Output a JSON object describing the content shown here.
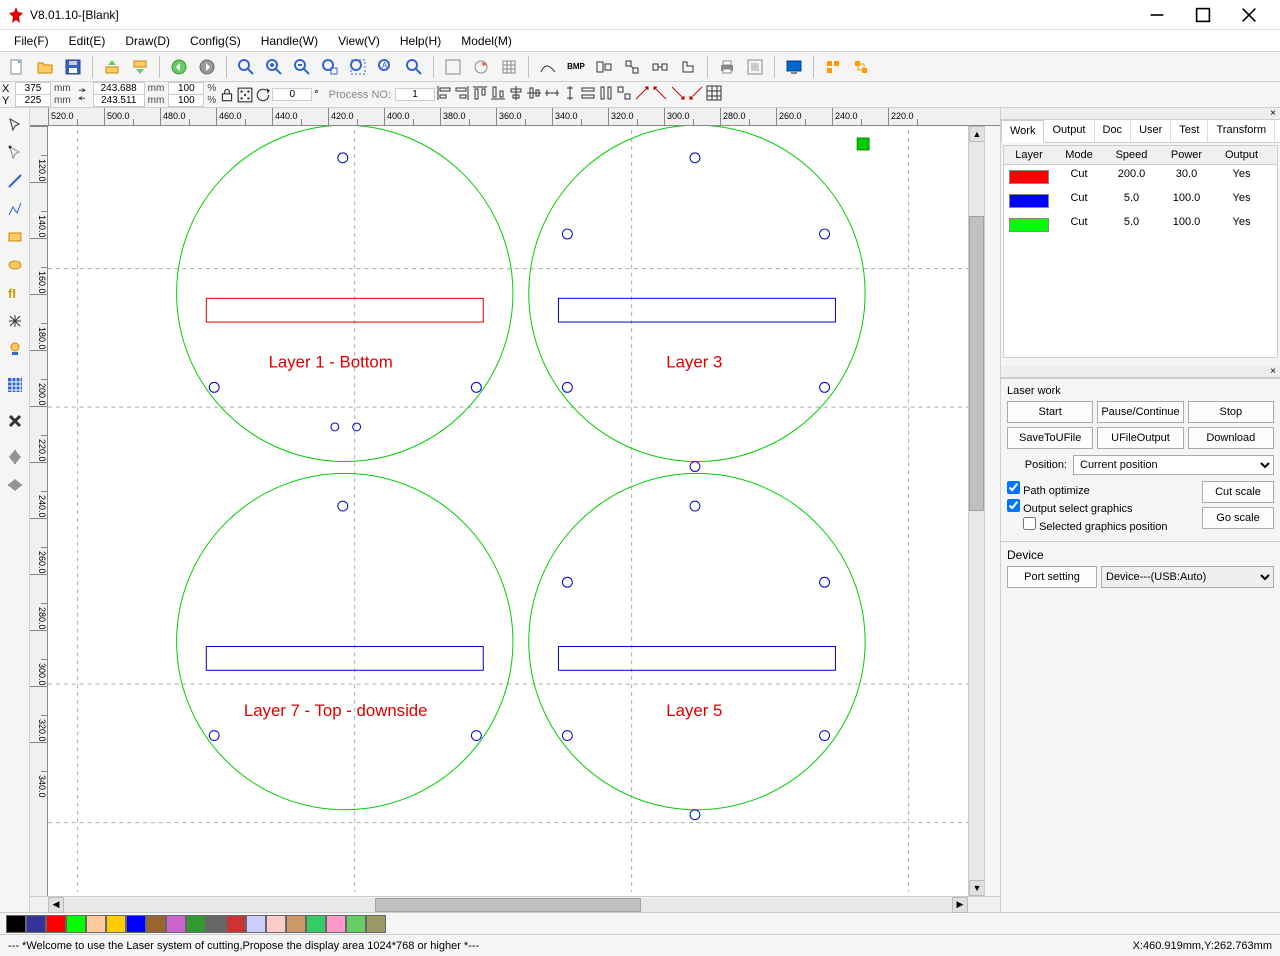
{
  "window": {
    "title": "V8.01.10-[Blank]"
  },
  "menu": {
    "file": "File(F)",
    "edit": "Edit(E)",
    "draw": "Draw(D)",
    "config": "Config(S)",
    "handle": "Handle(W)",
    "view": "View(V)",
    "help": "Help(H)",
    "model": "Model(M)"
  },
  "coords": {
    "x_label": "X",
    "x_val": "375",
    "x_unit": "mm",
    "y_label": "Y",
    "y_val": "225",
    "y_unit": "mm",
    "w_val": "243.688",
    "w_unit": "mm",
    "h_val": "243.511",
    "h_unit": "mm",
    "sx_val": "100",
    "sx_unit": "%",
    "sy_val": "100",
    "sy_unit": "%",
    "rot_val": "0",
    "process_label": "Process NO:",
    "process_val": "1"
  },
  "ruler_h": [
    "520.0",
    "500.0",
    "480.0",
    "460.0",
    "440.0",
    "420.0",
    "400.0",
    "380.0",
    "360.0",
    "340.0",
    "320.0",
    "300.0",
    "280.0",
    "260.0",
    "240.0",
    "220.0"
  ],
  "ruler_v": [
    "120.0",
    "140.0",
    "160.0",
    "180.0",
    "200.0",
    "220.0",
    "240.0",
    "260.0",
    "280.0",
    "300.0",
    "320.0",
    "340.0"
  ],
  "canvas": {
    "labels": {
      "l1": "Layer 1 - Bottom",
      "l3": "Layer 3",
      "l7": "Layer 7 - Top - downside",
      "l5": "Layer 5"
    }
  },
  "rp": {
    "tabs": {
      "work": "Work",
      "output": "Output",
      "doc": "Doc",
      "user": "User",
      "test": "Test",
      "transform": "Transform"
    },
    "layer_hdr": {
      "layer": "Layer",
      "mode": "Mode",
      "speed": "Speed",
      "power": "Power",
      "output": "Output"
    },
    "layers": [
      {
        "color": "#ff0000",
        "mode": "Cut",
        "speed": "200.0",
        "power": "30.0",
        "output": "Yes"
      },
      {
        "color": "#0000ff",
        "mode": "Cut",
        "speed": "5.0",
        "power": "100.0",
        "output": "Yes"
      },
      {
        "color": "#00ff00",
        "mode": "Cut",
        "speed": "5.0",
        "power": "100.0",
        "output": "Yes"
      }
    ],
    "laser_work_title": "Laser work",
    "btns": {
      "start": "Start",
      "pause": "Pause/Continue",
      "stop": "Stop",
      "saveu": "SaveToUFile",
      "ufile": "UFileOutput",
      "download": "Download"
    },
    "position_label": "Position:",
    "position_value": "Current position",
    "chk_path": "Path optimize",
    "chk_outsel": "Output select graphics",
    "chk_selpos": "Selected graphics position",
    "cut_scale": "Cut scale",
    "go_scale": "Go scale",
    "device_title": "Device",
    "port_setting": "Port setting",
    "device_value": "Device---(USB:Auto)"
  },
  "palette": [
    "#000000",
    "#333399",
    "#ff0000",
    "#00ff00",
    "#ffcc99",
    "#ffcc00",
    "#0000ff",
    "#996633",
    "#cc66cc",
    "#339933",
    "#666666",
    "#cc3333",
    "#ccccff",
    "#ffcccc",
    "#cc9966",
    "#33cc66",
    "#ff99cc",
    "#66cc66",
    "#999966"
  ],
  "status": {
    "left": "--- *Welcome to use the Laser system of cutting,Propose the display area 1024*768 or higher *---",
    "right": "X:460.919mm,Y:262.763mm"
  }
}
